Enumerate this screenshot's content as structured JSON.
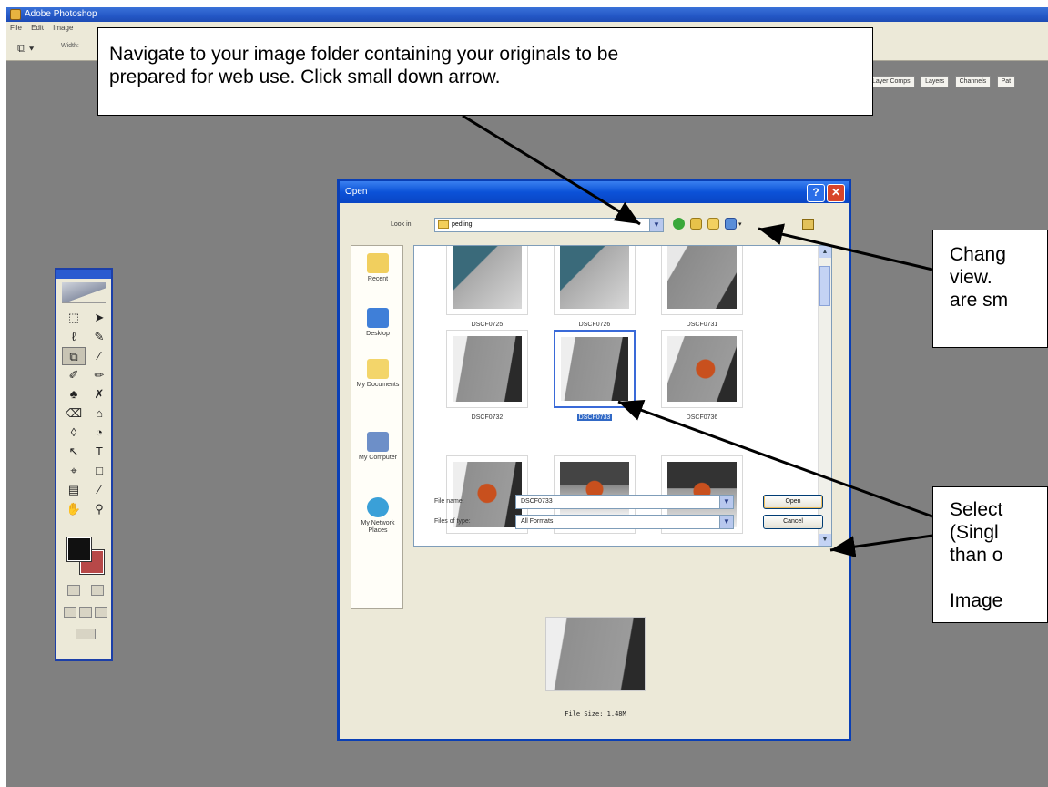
{
  "photoshop": {
    "title": "Adobe Photoshop",
    "menu": [
      "File",
      "Edit",
      "Image"
    ],
    "options_label": "Width:",
    "palette_tabs": [
      "Layer Comps",
      "Layers",
      "Channels",
      "Pat"
    ]
  },
  "dialog": {
    "title": "Open",
    "help_glyph": "?",
    "close_glyph": "✕",
    "look_in_label": "Look in:",
    "look_in_value": "pedling",
    "places": [
      "Recent",
      "Desktop",
      "My Documents",
      "My Computer",
      "My Network Places"
    ],
    "thumbnails": [
      {
        "name": "DSCF0725",
        "selected": false
      },
      {
        "name": "DSCF0726",
        "selected": false
      },
      {
        "name": "DSCF0731",
        "selected": false
      },
      {
        "name": "DSCF0732",
        "selected": false
      },
      {
        "name": "DSCF0733",
        "selected": true
      },
      {
        "name": "DSCF0736",
        "selected": false
      },
      {
        "name": "",
        "selected": false
      },
      {
        "name": "",
        "selected": false
      },
      {
        "name": "",
        "selected": false
      }
    ],
    "file_name_label": "File name:",
    "file_name_value": "DSCF0733",
    "files_of_type_label": "Files of type:",
    "files_of_type_value": "All Formats",
    "open_button": "Open",
    "cancel_button": "Cancel",
    "file_size": "File Size: 1.48M"
  },
  "callouts": {
    "top": "Navigate to your image folder containing your originals to be\nprepared for web use. Click small down arrow.",
    "right_top": "Chang\nview. \nare sm",
    "right_bottom": "Select\n(Singl\nthan o\n\nImage"
  },
  "colors": {
    "xp_title_blue": "#0a46c4",
    "dialog_border": "#0a3fb5",
    "workspace_gray": "#808080",
    "selection_blue": "#3169c6",
    "foreground_color": "#111111",
    "background_color": "#b74848"
  }
}
